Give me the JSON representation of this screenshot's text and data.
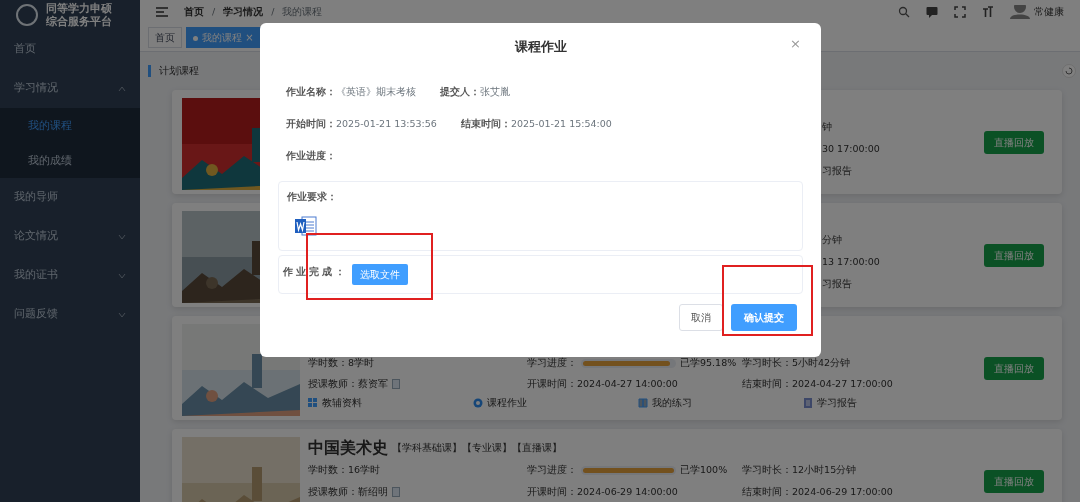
{
  "sidebar": {
    "brand": [
      "同等学力申硕",
      "综合服务平台"
    ],
    "items": [
      {
        "label": "首页",
        "selected": false
      },
      {
        "label": "学习情况",
        "selected": false,
        "expanded": true,
        "children": [
          {
            "label": "我的课程",
            "selected": true
          },
          {
            "label": "我的成绩",
            "selected": false
          }
        ]
      },
      {
        "label": "我的导师",
        "selected": false
      },
      {
        "label": "论文情况",
        "selected": false,
        "expanded": false
      },
      {
        "label": "我的证书",
        "selected": false,
        "expanded": false
      },
      {
        "label": "问题反馈",
        "selected": false,
        "expanded": false
      }
    ]
  },
  "breadcrumb": [
    "首页",
    "学习情况",
    "我的课程"
  ],
  "breadcrumb_separator": "/",
  "user": {
    "name": "常健康"
  },
  "tags": [
    {
      "label": "首页",
      "selected": false
    },
    {
      "label": "我的课程",
      "selected": true,
      "close": "×"
    }
  ],
  "section_title": "计划课程",
  "courses": [
    {
      "kind": "partial",
      "fragments": [
        "钟",
        "30 17:00:00",
        "习报告"
      ],
      "button": "直播回放"
    },
    {
      "kind": "partial",
      "fragments": [
        "分钟",
        "13 17:00:00",
        "习报告"
      ],
      "button": "直播回放"
    },
    {
      "kind": "full",
      "hours": "学时数：8学时",
      "progress_label": "学习进度：",
      "level": 0.9518,
      "reading": "已学95.18%",
      "duration": "学习时长：5小时42分钟",
      "teacher": "授课教师：蔡资军",
      "start": "开课时间：2024-04-27 14:00:00",
      "end": "结束时间：2024-04-27 17:00:00",
      "links": [
        "教辅资料",
        "课程作业",
        "我的练习",
        "学习报告"
      ],
      "button": "直播回放"
    },
    {
      "kind": "full",
      "title": "中国美术史",
      "tags": "【学科基础课】【专业课】【直播课】",
      "hours": "学时数：16学时",
      "progress_label": "学习进度：",
      "level": 1,
      "reading": "已学100%",
      "duration": "学习时长：12小时15分钟",
      "teacher": "授课教师：靳绍明",
      "start": "开课时间：2024-06-29 14:00:00",
      "end": "结束时间：2024-06-29 17:00:00",
      "button": "直播回放"
    }
  ],
  "dialog": {
    "title": "课程作业",
    "close": "×",
    "fields": [
      [
        {
          "label": "作业名称：",
          "value": "《英语》期末考核"
        },
        {
          "label": "提交人：",
          "value": "张艾胤"
        }
      ],
      [
        {
          "label": "开始时间：",
          "value": "2025-01-21 13:53:56"
        },
        {
          "label": "结束时间：",
          "value": "2025-01-21 15:54:00"
        }
      ],
      [
        {
          "label": "作业进度："
        }
      ]
    ],
    "requirement_label": "作业要求：",
    "upload": {
      "label": "作业完成：",
      "button": "选取文件",
      "highlight": true
    },
    "cancel": "取消",
    "submit": {
      "label": "确认提交",
      "highlight": true
    }
  }
}
